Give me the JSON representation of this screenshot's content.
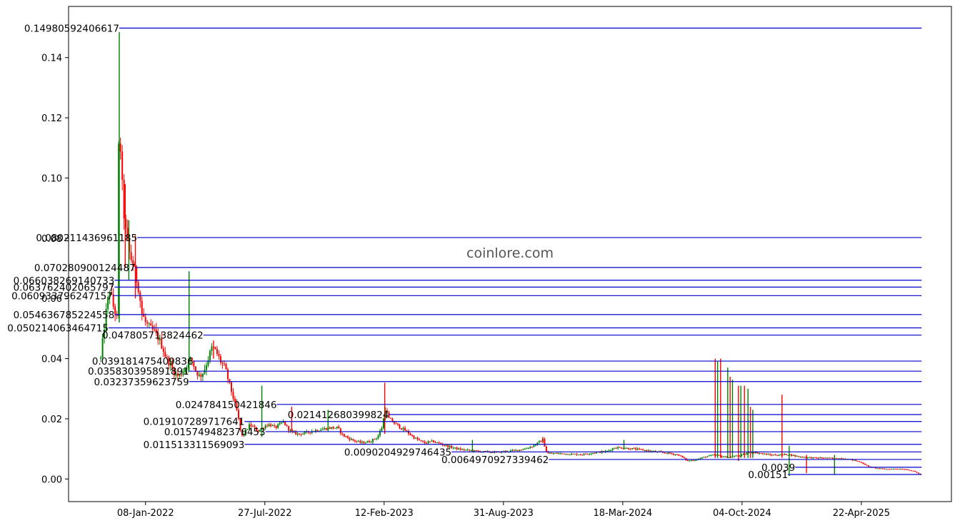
{
  "chart_data": {
    "type": "candlestick",
    "watermark": "coinlore.com",
    "x_tick_labels": [
      "08-Jan-2022",
      "27-Jul-2022",
      "12-Feb-2023",
      "31-Aug-2023",
      "18-Mar-2024",
      "04-Oct-2024",
      "22-Apr-2025"
    ],
    "x_ticks_iso": [
      "2022-01-08",
      "2022-07-27",
      "2023-02-12",
      "2023-08-31",
      "2024-03-18",
      "2024-10-04",
      "2025-04-22"
    ],
    "xlim": [
      "2021-09-01",
      "2025-09-20"
    ],
    "ylim": [
      -0.0075,
      0.157
    ],
    "y_tick_labels": [
      "0.00",
      "0.02",
      "0.04",
      "0.06",
      "0.08",
      "0.10",
      "0.12",
      "0.14"
    ],
    "y_ticks": [
      0,
      0.02,
      0.04,
      0.06,
      0.08,
      0.1,
      0.12,
      0.14
    ],
    "grid": false,
    "colors": {
      "up": "#008000",
      "down": "#ff0000",
      "level": "#0000cc",
      "axis": "#000000"
    },
    "price_path": [
      [
        "2021-10-25",
        0.04
      ],
      [
        "2021-10-30",
        0.049
      ],
      [
        "2021-11-04",
        0.057
      ],
      [
        "2021-11-09",
        0.063
      ],
      [
        "2021-11-14",
        0.058
      ],
      [
        "2021-11-19",
        0.055
      ],
      [
        "2021-11-22",
        0.052
      ],
      [
        "2021-11-25",
        0.138
      ],
      [
        "2021-11-27",
        0.11
      ],
      [
        "2021-11-29",
        0.1
      ],
      [
        "2021-12-02",
        0.09
      ],
      [
        "2021-12-07",
        0.08
      ],
      [
        "2021-12-12",
        0.075
      ],
      [
        "2021-12-17",
        0.072
      ],
      [
        "2021-12-22",
        0.068
      ],
      [
        "2021-12-27",
        0.064
      ],
      [
        "2022-01-02",
        0.055
      ],
      [
        "2022-01-08",
        0.052
      ],
      [
        "2022-01-15",
        0.05
      ],
      [
        "2022-01-22",
        0.049
      ],
      [
        "2022-01-29",
        0.047
      ],
      [
        "2022-02-05",
        0.044
      ],
      [
        "2022-02-12",
        0.04
      ],
      [
        "2022-02-19",
        0.038
      ],
      [
        "2022-02-26",
        0.035
      ],
      [
        "2022-03-05",
        0.034
      ],
      [
        "2022-03-12",
        0.036
      ],
      [
        "2022-03-19",
        0.038
      ],
      [
        "2022-03-26",
        0.04
      ],
      [
        "2022-04-02",
        0.036
      ],
      [
        "2022-04-09",
        0.034
      ],
      [
        "2022-04-16",
        0.036
      ],
      [
        "2022-04-23",
        0.04
      ],
      [
        "2022-04-30",
        0.044
      ],
      [
        "2022-05-07",
        0.042
      ],
      [
        "2022-05-14",
        0.039
      ],
      [
        "2022-05-21",
        0.037
      ],
      [
        "2022-05-28",
        0.032
      ],
      [
        "2022-06-04",
        0.027
      ],
      [
        "2022-06-11",
        0.022
      ],
      [
        "2022-06-18",
        0.014
      ],
      [
        "2022-06-25",
        0.016
      ],
      [
        "2022-07-02",
        0.018
      ],
      [
        "2022-07-09",
        0.017
      ],
      [
        "2022-07-16",
        0.016
      ],
      [
        "2022-07-23",
        0.017
      ],
      [
        "2022-07-30",
        0.018
      ],
      [
        "2022-08-06",
        0.018
      ],
      [
        "2022-08-13",
        0.017
      ],
      [
        "2022-08-20",
        0.018
      ],
      [
        "2022-08-27",
        0.019
      ],
      [
        "2022-09-03",
        0.017
      ],
      [
        "2022-09-10",
        0.0155
      ],
      [
        "2022-09-20",
        0.015
      ],
      [
        "2022-10-01",
        0.0152
      ],
      [
        "2022-10-15",
        0.016
      ],
      [
        "2022-10-29",
        0.0165
      ],
      [
        "2022-11-12",
        0.017
      ],
      [
        "2022-11-26",
        0.017
      ],
      [
        "2022-12-05",
        0.0145
      ],
      [
        "2022-12-20",
        0.013
      ],
      [
        "2023-01-05",
        0.012
      ],
      [
        "2023-01-20",
        0.0125
      ],
      [
        "2023-02-01",
        0.014
      ],
      [
        "2023-02-10",
        0.018
      ],
      [
        "2023-02-13",
        0.024
      ],
      [
        "2023-02-20",
        0.02
      ],
      [
        "2023-03-05",
        0.018
      ],
      [
        "2023-03-20",
        0.016
      ],
      [
        "2023-04-05",
        0.0135
      ],
      [
        "2023-04-20",
        0.012
      ],
      [
        "2023-05-05",
        0.0125
      ],
      [
        "2023-05-20",
        0.0115
      ],
      [
        "2023-06-05",
        0.0105
      ],
      [
        "2023-06-20",
        0.0098
      ],
      [
        "2023-07-05",
        0.0095
      ],
      [
        "2023-07-20",
        0.0092
      ],
      [
        "2023-08-05",
        0.009
      ],
      [
        "2023-08-20",
        0.0089
      ],
      [
        "2023-09-05",
        0.0092
      ],
      [
        "2023-09-20",
        0.0095
      ],
      [
        "2023-10-05",
        0.01
      ],
      [
        "2023-10-20",
        0.011
      ],
      [
        "2023-11-05",
        0.013
      ],
      [
        "2023-11-12",
        0.0085
      ],
      [
        "2023-12-01",
        0.0085
      ],
      [
        "2023-12-20",
        0.0083
      ],
      [
        "2024-01-10",
        0.0082
      ],
      [
        "2024-02-01",
        0.0088
      ],
      [
        "2024-02-20",
        0.0092
      ],
      [
        "2024-03-05",
        0.0105
      ],
      [
        "2024-03-20",
        0.0103
      ],
      [
        "2024-04-05",
        0.01
      ],
      [
        "2024-04-25",
        0.0095
      ],
      [
        "2024-05-15",
        0.009
      ],
      [
        "2024-06-05",
        0.0085
      ],
      [
        "2024-06-20",
        0.008
      ],
      [
        "2024-07-05",
        0.006
      ],
      [
        "2024-07-20",
        0.0065
      ],
      [
        "2024-08-05",
        0.0075
      ],
      [
        "2024-08-20",
        0.008
      ],
      [
        "2024-09-01",
        0.0075
      ],
      [
        "2024-09-10",
        0.0072
      ],
      [
        "2024-09-20",
        0.0075
      ],
      [
        "2024-10-04",
        0.008
      ],
      [
        "2024-10-20",
        0.009
      ],
      [
        "2024-11-05",
        0.0085
      ],
      [
        "2024-11-20",
        0.008
      ],
      [
        "2024-12-05",
        0.008
      ],
      [
        "2024-12-20",
        0.0082
      ],
      [
        "2025-01-05",
        0.0075
      ],
      [
        "2025-01-20",
        0.0072
      ],
      [
        "2025-02-05",
        0.007
      ],
      [
        "2025-02-20",
        0.007
      ],
      [
        "2025-03-05",
        0.0068
      ],
      [
        "2025-03-20",
        0.0069
      ],
      [
        "2025-04-05",
        0.0065
      ],
      [
        "2025-04-22",
        0.0055
      ],
      [
        "2025-05-05",
        0.004
      ],
      [
        "2025-05-20",
        0.0035
      ],
      [
        "2025-06-05",
        0.0033
      ],
      [
        "2025-06-20",
        0.0034
      ],
      [
        "2025-07-05",
        0.0033
      ],
      [
        "2025-07-20",
        0.0025
      ],
      [
        "2025-08-01",
        0.0013
      ]
    ],
    "spikes": [
      [
        "2021-11-25",
        0.1485,
        0.052
      ],
      [
        "2021-12-05",
        0.098,
        0.07
      ],
      [
        "2021-12-11",
        0.086,
        0.066
      ],
      [
        "2021-12-22",
        0.081,
        0.06
      ],
      [
        "2022-03-22",
        0.069,
        0.036
      ],
      [
        "2022-05-02",
        0.046,
        0.04
      ],
      [
        "2022-07-22",
        0.031,
        0.014
      ],
      [
        "2022-09-10",
        0.024,
        0.016
      ],
      [
        "2022-11-10",
        0.023,
        0.016
      ],
      [
        "2023-02-13",
        0.032,
        0.015
      ],
      [
        "2023-07-10",
        0.013,
        0.009
      ],
      [
        "2023-11-05",
        0.014,
        0.012
      ],
      [
        "2024-03-20",
        0.013,
        0.01
      ],
      [
        "2024-08-20",
        0.04,
        0.007
      ],
      [
        "2024-08-24",
        0.039,
        0.007
      ],
      [
        "2024-08-29",
        0.04,
        0.007
      ],
      [
        "2024-09-10",
        0.037,
        0.007
      ],
      [
        "2024-09-14",
        0.034,
        0.007
      ],
      [
        "2024-09-18",
        0.033,
        0.007
      ],
      [
        "2024-09-28",
        0.031,
        0.006
      ],
      [
        "2024-10-02",
        0.031,
        0.007
      ],
      [
        "2024-10-08",
        0.031,
        0.007
      ],
      [
        "2024-10-14",
        0.03,
        0.007
      ],
      [
        "2024-10-18",
        0.024,
        0.007
      ],
      [
        "2024-10-22",
        0.023,
        0.007
      ],
      [
        "2024-12-10",
        0.028,
        0.007
      ],
      [
        "2024-12-22",
        0.011,
        0.001
      ],
      [
        "2025-01-20",
        0.008,
        0.002
      ],
      [
        "2025-03-08",
        0.008,
        0.0015
      ]
    ],
    "levels": [
      {
        "label": "0.14980592406617",
        "value": 0.14980592406617,
        "start": "2021-11-25"
      },
      {
        "label": "0.080211436961185",
        "value": 0.080211436961185,
        "start": "2021-12-25"
      },
      {
        "label": "0.070280900124487",
        "value": 0.070280900124487,
        "start": "2021-12-22"
      },
      {
        "label": "0.066038269140733",
        "value": 0.066038269140733,
        "start": "2021-11-17"
      },
      {
        "label": "0.063762402065797",
        "value": 0.063762402065797,
        "start": "2021-11-17"
      },
      {
        "label": "0.060933796247157",
        "value": 0.060933796247157,
        "start": "2021-11-14"
      },
      {
        "label": "0.054636785224558",
        "value": 0.054636785224558,
        "start": "2021-11-17"
      },
      {
        "label": "0.050214063464715",
        "value": 0.050214063464715,
        "start": "2021-11-07"
      },
      {
        "label": "0.047805713824462",
        "value": 0.047805713824462,
        "start": "2022-04-15"
      },
      {
        "label": "0.039181475409836",
        "value": 0.039181475409836,
        "start": "2022-03-29"
      },
      {
        "label": "0.035830395891891",
        "value": 0.035830395891891,
        "start": "2022-03-22"
      },
      {
        "label": "0.03237359623759",
        "value": 0.03237359623759,
        "start": "2022-03-22"
      },
      {
        "label": "0.024784150421846",
        "value": 0.024784150421846,
        "start": "2022-08-16"
      },
      {
        "label": "0.021412680399824",
        "value": 0.021412680399824,
        "start": "2023-02-20"
      },
      {
        "label": "0.019107289717641",
        "value": 0.019107289717641,
        "start": "2022-06-23"
      },
      {
        "label": "0.015749482376453",
        "value": 0.015749482376453,
        "start": "2022-07-28"
      },
      {
        "label": "0.011513311569093",
        "value": 0.011513311569093,
        "start": "2022-06-23"
      },
      {
        "label": "0.0090204929746435",
        "value": 0.0090204929746435,
        "start": "2023-06-05"
      },
      {
        "label": "0.0064970927339462",
        "value": 0.0064970927339462,
        "start": "2023-11-15"
      },
      {
        "label": "0.0039",
        "value": 0.0039,
        "start": "2025-01-01"
      },
      {
        "label": "0.00151",
        "value": 0.00151,
        "start": "2024-12-20"
      }
    ]
  }
}
